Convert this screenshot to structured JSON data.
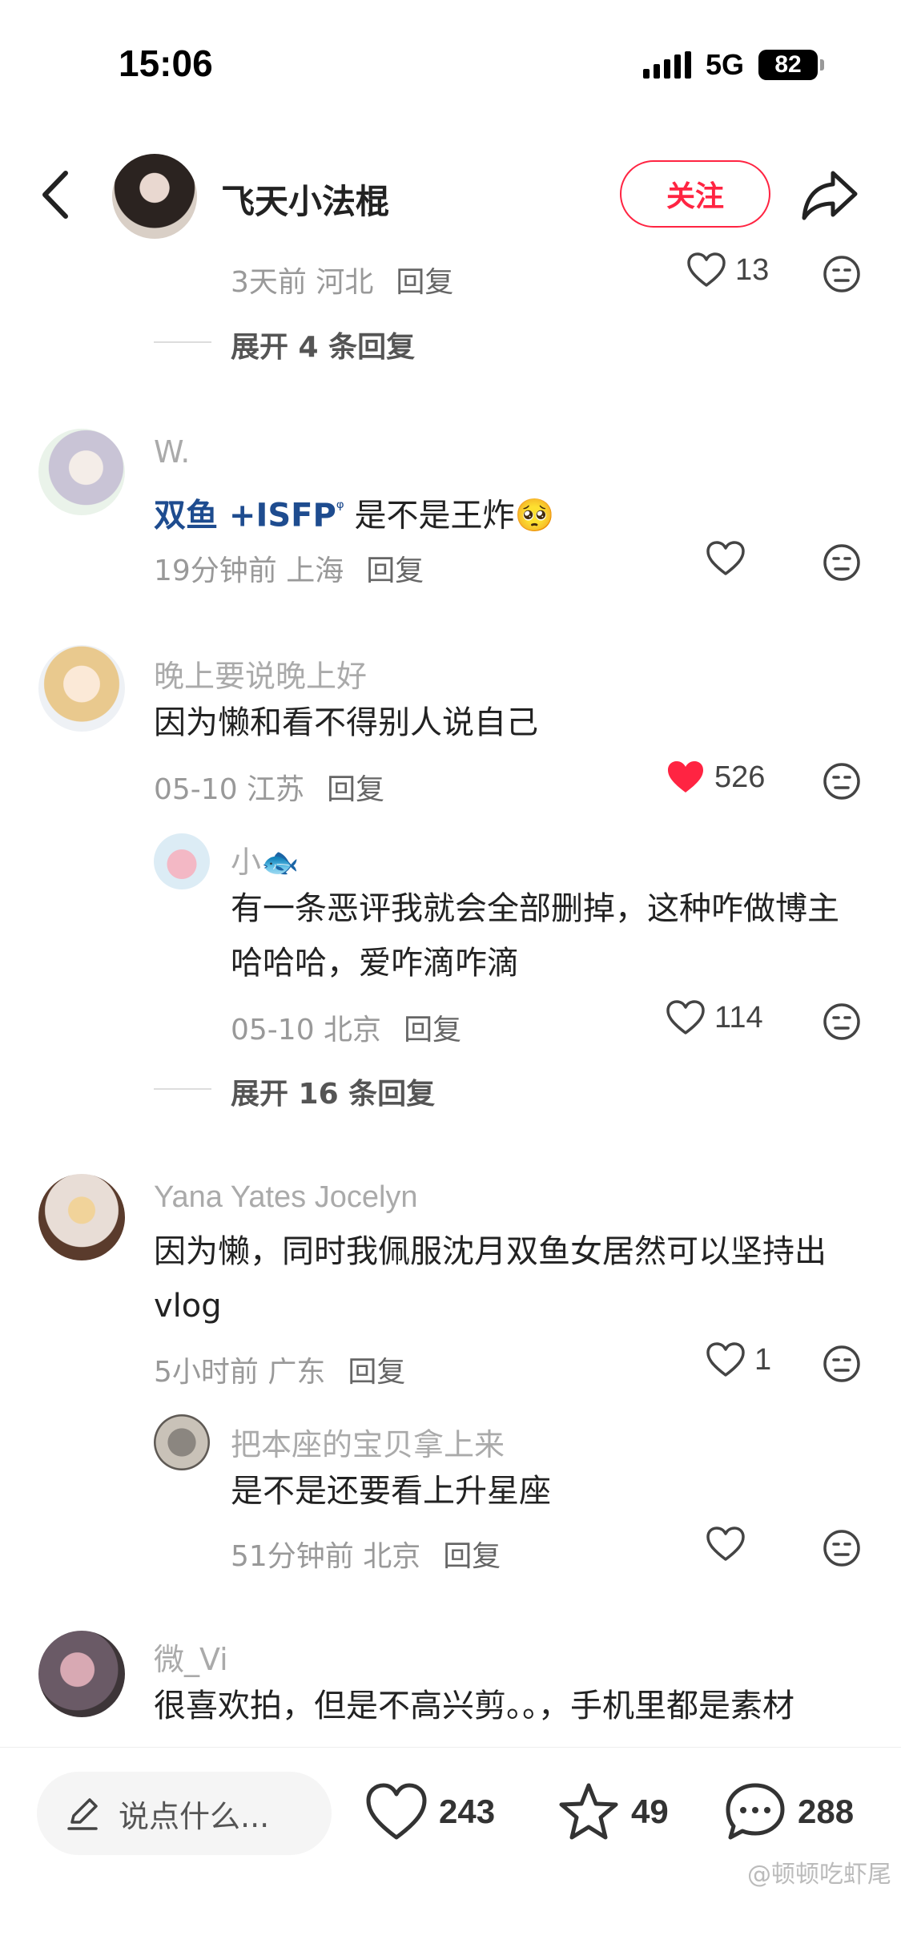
{
  "status_bar": {
    "time": "15:06",
    "network": "5G",
    "battery": "82"
  },
  "header": {
    "author_name": "飞天小法棍",
    "follow_label": "关注"
  },
  "reply_label": "回复",
  "top_fragment": {
    "meta": "3天前 河北",
    "likes": "13",
    "expand": "展开 4 条回复"
  },
  "comments": [
    {
      "user": "W.",
      "topic": "双鱼 +ISFP",
      "topic_mark": "ᵠ",
      "text": " 是不是王炸",
      "emoji": "🥺",
      "meta": "19分钟前 上海",
      "likes": ""
    },
    {
      "user": "晚上要说晚上好",
      "text": "因为懒和看不得别人说自己",
      "meta": "05-10 江苏",
      "likes": "526",
      "liked": true,
      "reply": {
        "user": "小🐟",
        "text": "有一条恶评我就会全部删掉，这种咋做博主哈哈哈，爱咋滴咋滴",
        "meta": "05-10 北京",
        "likes": "114"
      },
      "expand": "展开 16 条回复"
    },
    {
      "user": "Yana Yates Jocelyn",
      "text": "因为懒，同时我佩服沈月双鱼女居然可以坚持出vlog",
      "meta": "5小时前 广东",
      "likes": "1",
      "reply": {
        "user": "把本座的宝贝拿上来",
        "text": "是不是还要看上升星座",
        "meta": "51分钟前 北京",
        "likes": ""
      }
    },
    {
      "user": "微_Vi",
      "text": "很喜欢拍，但是不高兴剪。。，手机里都是素材"
    }
  ],
  "bottom_bar": {
    "input_placeholder": "说点什么...",
    "likes": "243",
    "collects": "49",
    "comments": "288"
  },
  "watermark": "@顿顿吃虾尾",
  "colors": {
    "accent": "#ff2442",
    "topic": "#1e4c8f",
    "meta": "#999999"
  }
}
